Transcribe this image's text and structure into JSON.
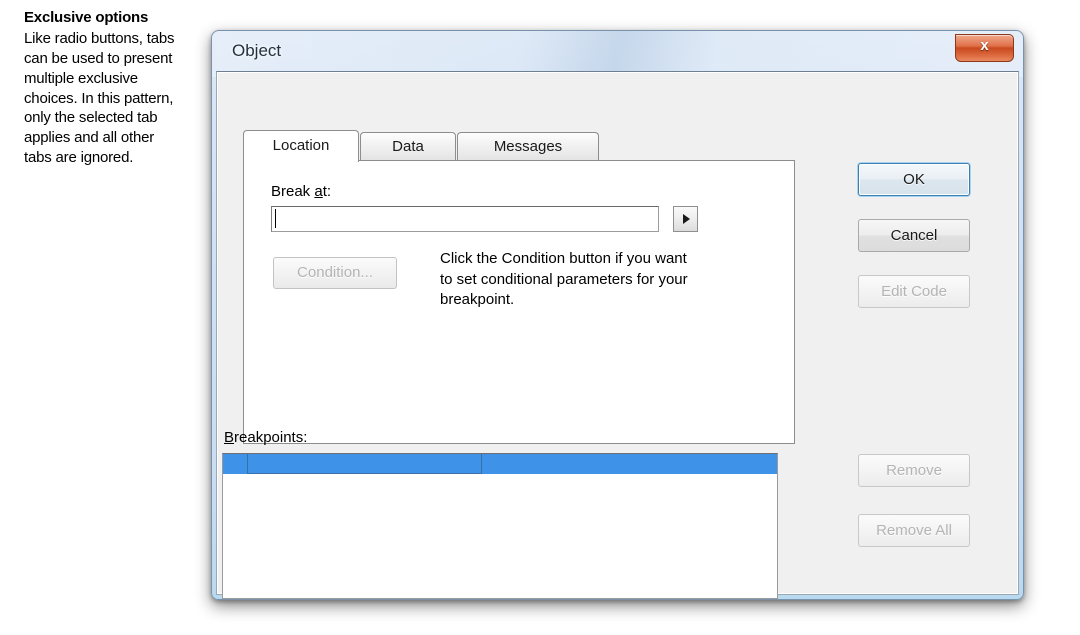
{
  "annotation": {
    "title": "Exclusive options",
    "body": "Like radio buttons, tabs can be used to present multiple exclusive choices. In this pattern, only the selected tab applies and all other tabs are ignored."
  },
  "dialog": {
    "title": "Object",
    "close_glyph": "x",
    "tabs": [
      {
        "label": "Location",
        "selected": true
      },
      {
        "label": "Data",
        "selected": false
      },
      {
        "label": "Messages",
        "selected": false
      }
    ],
    "location_tab": {
      "break_at": {
        "label_pre": "Break ",
        "label_accel": "a",
        "label_post": "t:",
        "value": "",
        "placeholder": "",
        "dropdown_icon": "right-arrow-icon"
      },
      "condition_button": {
        "label": "Condition...",
        "enabled": false
      },
      "condition_help": "Click the Condition button if you want to set conditional parameters for your breakpoint."
    },
    "breakpoints": {
      "label_accel": "B",
      "label_post": "reakpoints:",
      "columns": [
        "",
        "",
        ""
      ],
      "rows": [],
      "header_color": "#3e93e8"
    },
    "buttons": [
      {
        "id": "ok",
        "label": "OK",
        "enabled": true,
        "default": true
      },
      {
        "id": "cancel",
        "label": "Cancel",
        "enabled": true,
        "default": false
      },
      {
        "id": "edit-code",
        "label": "Edit Code",
        "enabled": false,
        "default": false
      },
      {
        "id": "remove",
        "label": "Remove",
        "enabled": false,
        "default": false
      },
      {
        "id": "remove-all",
        "label": "Remove All",
        "enabled": false,
        "default": false
      }
    ]
  },
  "colors": {
    "titlebar_glass": "#cfe0f4",
    "close_red": "#d9582c",
    "selection_blue": "#3e93e8",
    "dialog_face": "#f0f0f0",
    "focus_ring": "#3c7fb1"
  }
}
